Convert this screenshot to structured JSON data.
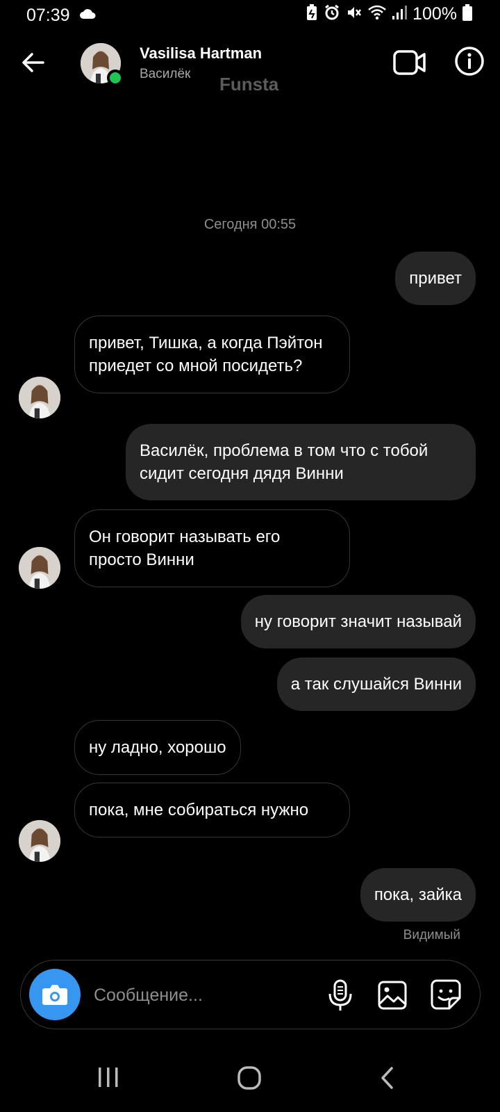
{
  "status_bar": {
    "time": "07:39",
    "battery": "100%",
    "icons": [
      "cloud-icon",
      "battery-saver-icon",
      "alarm-icon",
      "mute-icon",
      "wifi-icon",
      "signal-icon",
      "battery-icon"
    ]
  },
  "header": {
    "name": "Vasilisa Hartman",
    "username": "Василёк",
    "watermark": "Funsta",
    "online_color": "#23c552"
  },
  "chat": {
    "date": "Сегодня 00:55",
    "messages": [
      {
        "dir": "out",
        "text": "привет"
      },
      {
        "dir": "in",
        "text": "привет, Тишка, а когда Пэйтон приедет со мной посидеть?"
      },
      {
        "dir": "out",
        "text": "Василёк, проблема в том что с тобой сидит сегодня дядя Винни"
      },
      {
        "dir": "in",
        "text": "Он говорит называть его просто Винни"
      },
      {
        "dir": "out",
        "text": "ну говорит значит называй"
      },
      {
        "dir": "out",
        "text": "а так слушайся Винни"
      },
      {
        "dir": "in",
        "text": "ну ладно, хорошо"
      },
      {
        "dir": "in",
        "text": "пока, мне собираться нужно"
      },
      {
        "dir": "out",
        "text": "пока, зайка"
      }
    ],
    "seen_label": "Видимый"
  },
  "composer": {
    "placeholder": "Сообщение...",
    "accent": "#3797f0"
  },
  "colors": {
    "background": "#000000",
    "outgoing_bubble": "#262626",
    "incoming_border": "#363636"
  }
}
